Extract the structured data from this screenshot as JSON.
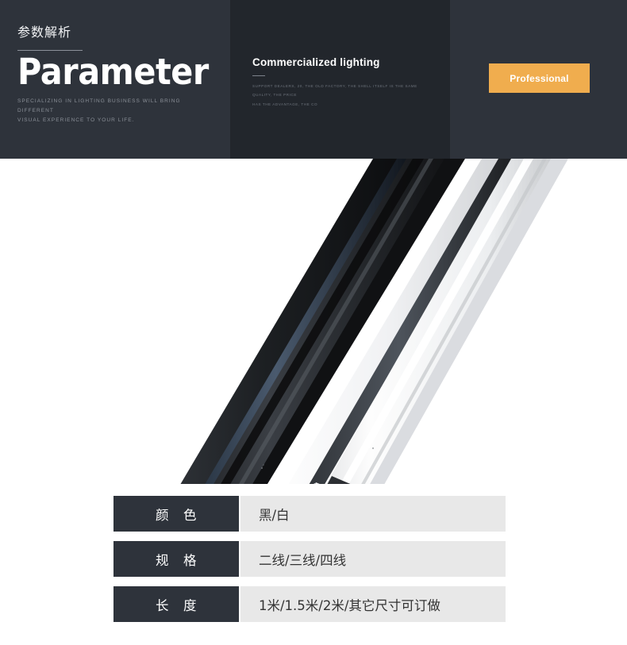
{
  "banner": {
    "cn_title": "参数解析",
    "en_title": "Parameter",
    "caption_line1": "SPECIALIZING IN LIGHTING BUSINESS WILL BRING DIFFERENT",
    "caption_line2": "VISUAL EXPERIENCE TO YOUR LIFE.",
    "mid_title": "Commercialized lighting",
    "mid_caption_line1": "SUPPORT DEALERS, 20, THE OLD FACTORY, THE SHELL ITSELF IS THE SAME QUALITY, THE PRICE",
    "mid_caption_line2": "HAS THE ADVANTAGE, THE CO",
    "button_label": "Professional",
    "colors": {
      "panel_outer": "#2e333b",
      "panel_inner": "#22262c",
      "accent": "#f0ad4e",
      "title_text": "#ffffff",
      "caption_text": "#8b9098"
    }
  },
  "product_photo": {
    "alt": "black and white track rail lighting bars",
    "background": "#ffffff"
  },
  "spec_table": {
    "rows": [
      {
        "label_a": "颜",
        "label_b": "色",
        "value": "黑/白"
      },
      {
        "label_a": "规",
        "label_b": "格",
        "value": "二线/三线/四线"
      },
      {
        "label_a": "长",
        "label_b": "度",
        "value": "1米/1.5米/2米/其它尺寸可订做"
      }
    ],
    "colors": {
      "label_bg": "#2e333b",
      "label_text": "#ffffff",
      "value_bg": "#e8e8e8",
      "value_text": "#333333"
    }
  }
}
